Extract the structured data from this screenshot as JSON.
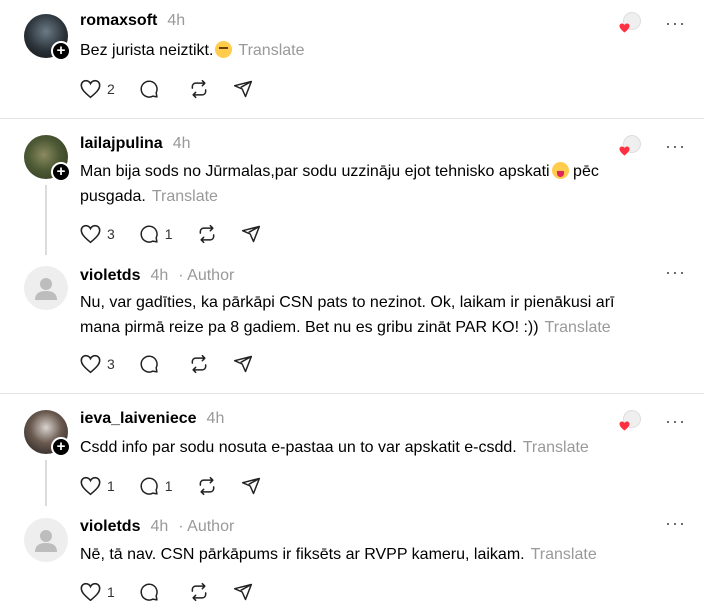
{
  "posts": [
    {
      "username": "romaxsoft",
      "time": "4h",
      "author_tag": "",
      "text": "Bez jurista neiztikt.",
      "emoji": "thinking-face",
      "translate": "Translate",
      "likes": "2",
      "comments": ""
    },
    {
      "username": "lailajpulina",
      "time": "4h",
      "author_tag": "",
      "text": "Man bija sods no Jūrmalas,par sodu uzzināju ejot tehnisko apskati",
      "text_after": " pēc pusgada.",
      "emoji": "tongue-face",
      "translate": "Translate",
      "likes": "3",
      "comments": "1"
    },
    {
      "username": "violetds",
      "time": "4h",
      "author_tag": "· Author",
      "text": "Nu, var gadīties, ka pārkāpi CSN pats to nezinot. Ok, laikam ir pienākusi arī mana pirmā reize pa 8 gadiem. Bet nu es gribu zināt PAR KO! :))",
      "translate": "Translate",
      "likes": "3",
      "comments": ""
    },
    {
      "username": "ieva_laiveniece",
      "time": "4h",
      "author_tag": "",
      "text": "Csdd info par sodu nosuta e-pastaa un to var apskatit e-csdd.",
      "translate": "Translate",
      "likes": "1",
      "comments": "1"
    },
    {
      "username": "violetds",
      "time": "4h",
      "author_tag": "· Author",
      "text": "Nē, tā nav. CSN pārkāpums ir fiksēts ar RVPP kameru, laikam.",
      "translate": "Translate",
      "likes": "1",
      "comments": ""
    }
  ],
  "icons": {
    "like": "heart-outline-icon",
    "comment": "comment-bubble-icon",
    "repost": "repost-icon",
    "share": "send-icon",
    "more": "more-dots-icon",
    "add": "plus-icon"
  },
  "colors": {
    "muted": "#999999",
    "reaction_heart": "#ff3040",
    "divider": "#e3e3e3"
  }
}
